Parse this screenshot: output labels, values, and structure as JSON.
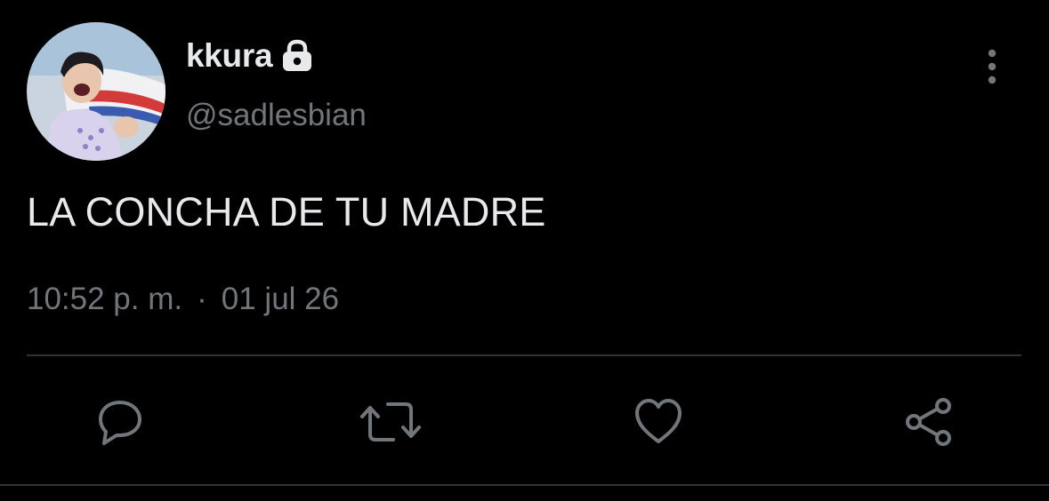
{
  "tweet": {
    "author": {
      "display_name": "kkura",
      "handle": "@sadlesbian",
      "avatar_icon": "profile-photo",
      "protected_icon": "lock-icon"
    },
    "text": "LA CONCHA DE TU MADRE",
    "time": "10:52 p. m.",
    "separator": "·",
    "date": "01 jul 26",
    "menu_icon": "more-vertical-icon",
    "actions": {
      "reply_icon": "reply-icon",
      "retweet_icon": "retweet-icon",
      "like_icon": "heart-icon",
      "share_icon": "share-icon"
    }
  },
  "colors": {
    "background": "#000000",
    "primary_text": "#e7e9ea",
    "secondary_text": "#71767b",
    "divider": "#2f3336"
  }
}
